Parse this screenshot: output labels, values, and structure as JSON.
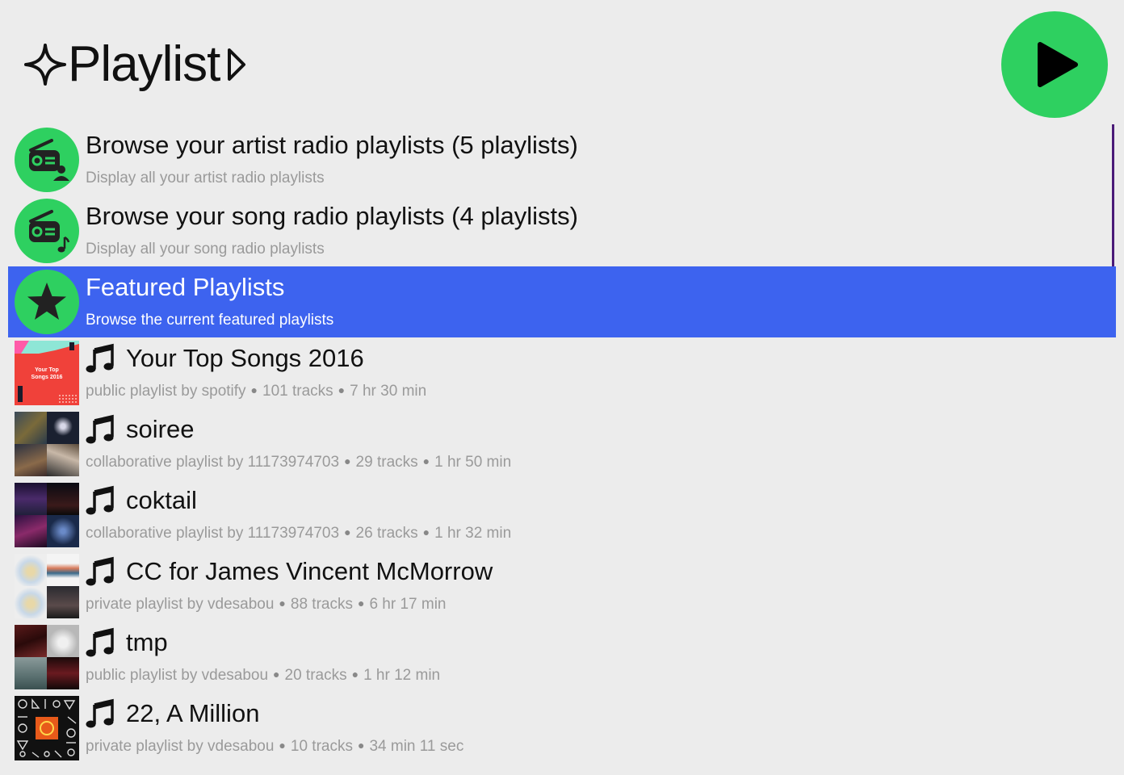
{
  "header": {
    "title": "Playlist",
    "sparkle_icon": "sparkle-icon",
    "triangle_icon": "triangle-right-outline-icon",
    "play_icon": "play-icon",
    "accent_color": "#2ed060"
  },
  "rows": [
    {
      "kind": "command",
      "icon": "radio-artist-icon",
      "title": "Browse your artist radio playlists (5 playlists)",
      "subtitle": "Display all your artist radio playlists"
    },
    {
      "kind": "command",
      "icon": "radio-song-icon",
      "title": "Browse your song radio playlists (4 playlists)",
      "subtitle": "Display all your song radio playlists"
    },
    {
      "kind": "command",
      "icon": "star-icon",
      "title": "Featured Playlists",
      "subtitle": "Browse the current featured playlists",
      "selected": true
    },
    {
      "kind": "playlist",
      "title": "Your Top Songs 2016",
      "cover_text": "Your Top Songs 2016",
      "meta": [
        "public playlist by spotify",
        "101 tracks",
        "7 hr 30 min"
      ]
    },
    {
      "kind": "playlist",
      "title": "soiree",
      "meta": [
        "collaborative playlist by 11173974703",
        "29 tracks",
        "1 hr 50 min"
      ]
    },
    {
      "kind": "playlist",
      "title": "coktail",
      "meta": [
        "collaborative playlist by 11173974703",
        "26 tracks",
        "1 hr 32 min"
      ]
    },
    {
      "kind": "playlist",
      "title": "CC for James Vincent McMorrow",
      "meta": [
        "private playlist by vdesabou",
        "88 tracks",
        "6 hr 17 min"
      ]
    },
    {
      "kind": "playlist",
      "title": "tmp",
      "meta": [
        "public playlist by vdesabou",
        "20 tracks",
        "1 hr 12 min"
      ]
    },
    {
      "kind": "playlist",
      "title": "22, A Million",
      "meta": [
        "private playlist by vdesabou",
        "10 tracks",
        "34 min 11 sec"
      ]
    }
  ],
  "selected_color": "#3d63ef"
}
